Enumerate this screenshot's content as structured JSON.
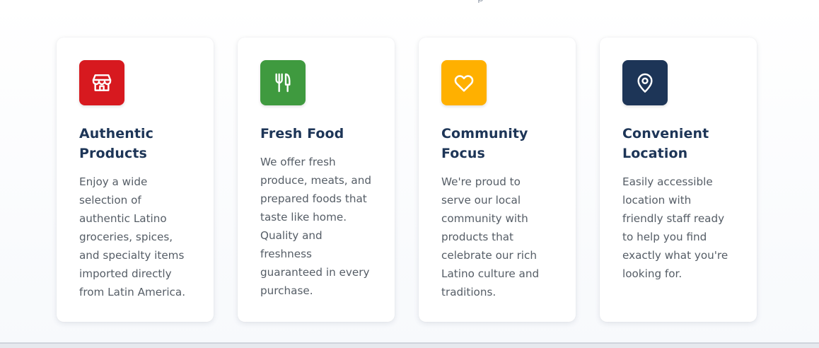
{
  "top_clipped_text": "p",
  "features": [
    {
      "icon": "store-icon",
      "color": "#d7191f",
      "title": "Authentic Products",
      "text": "Enjoy a wide selection of authentic Latino groceries, spices, and specialty items imported directly from Latin America."
    },
    {
      "icon": "utensils-icon",
      "color": "#3f9a3f",
      "title": "Fresh Food",
      "text": "We offer fresh produce, meats, and prepared foods that taste like home. Quality and freshness guaranteed in every purchase."
    },
    {
      "icon": "heart-icon",
      "color": "#ffb000",
      "title": "Community Focus",
      "text": "We're proud to serve our local community with products that celebrate our rich Latino culture and traditions."
    },
    {
      "icon": "map-pin-icon",
      "color": "#1d3557",
      "title": "Convenient Location",
      "text": "Easily accessible location with friendly staff ready to help you find exactly what you're looking for."
    }
  ]
}
